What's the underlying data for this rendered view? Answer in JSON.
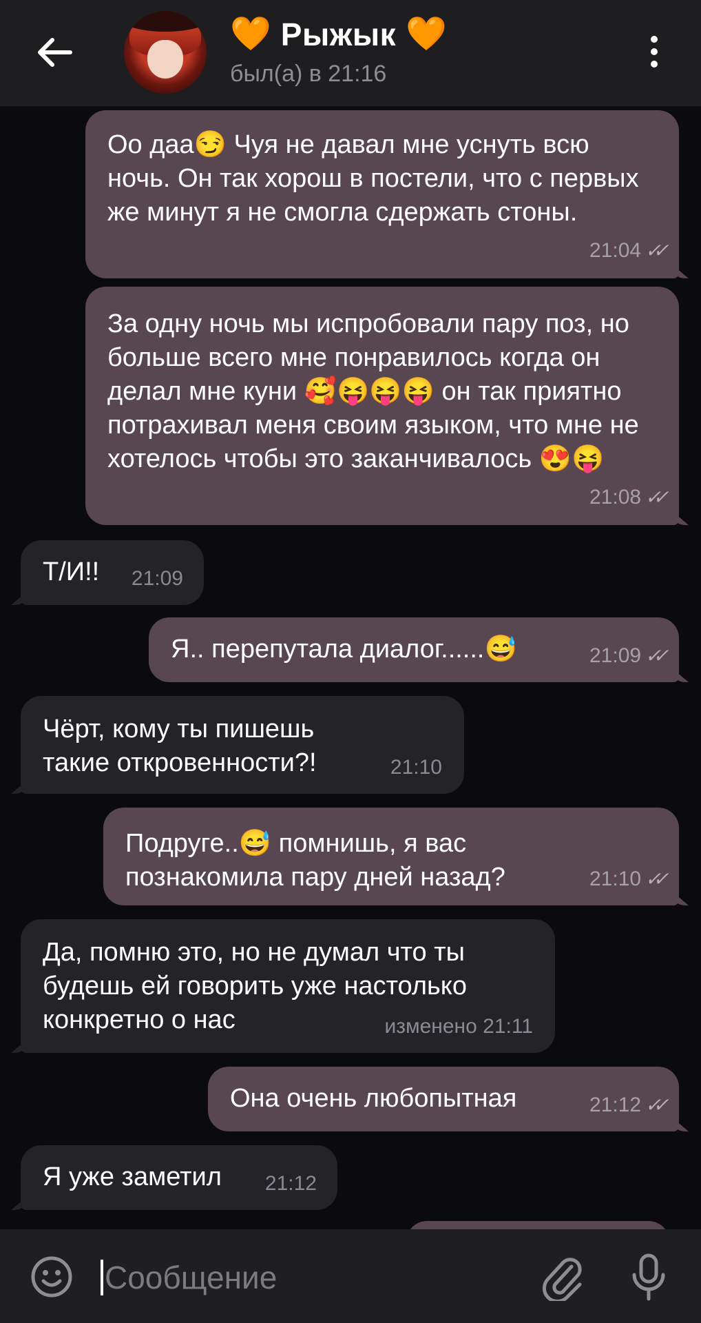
{
  "header": {
    "back_icon": "arrow-left-icon",
    "heart_left": "🧡",
    "name": "Рыжык",
    "heart_right": "🧡",
    "status": "был(а) в 21:16",
    "menu_icon": "more-vertical-icon"
  },
  "messages": [
    {
      "dir": "out",
      "text": "Оо даа😏 Чуя не давал мне уснуть всю ночь. Он так хорош в постели, что с первых же минут я не смогла сдержать стоны.",
      "time": "21:04",
      "read": true
    },
    {
      "dir": "out",
      "text": "За одну ночь мы испробовали пару поз, но больше всего мне понравилось когда он делал мне куни 🥰😝😝😝 он так приятно потрахивал меня своим языком, что мне не хотелось чтобы это заканчивалось 😍😝",
      "time": "21:08",
      "read": true
    },
    {
      "dir": "in",
      "text": "Т/И!!",
      "time": "21:09"
    },
    {
      "dir": "out",
      "text": "Я.. перепутала диалог......😅",
      "time": "21:09",
      "read": true
    },
    {
      "dir": "in",
      "text": "Чёрт, кому ты пишешь такие откровенности?!",
      "time": "21:10"
    },
    {
      "dir": "out",
      "text": "Подруге..😅 помнишь, я вас познакомила пару дней назад?",
      "time": "21:10",
      "read": true
    },
    {
      "dir": "in",
      "text": "Да, помню это, но не думал что ты будешь ей говорить уже настолько конкретно о нас",
      "time": "изменено 21:11"
    },
    {
      "dir": "out",
      "text": "Она очень любопытная",
      "time": "21:12",
      "read": true
    },
    {
      "dir": "in",
      "text": "Я уже заметил",
      "time": "21:12"
    }
  ],
  "read_mark": "✓✓",
  "input": {
    "placeholder": "Сообщение",
    "emoji_icon": "smile-icon",
    "attach_icon": "paperclip-icon",
    "mic_icon": "microphone-icon"
  },
  "colors": {
    "outgoing_bubble": "#584650",
    "incoming_bubble": "#242428",
    "background": "#0b0b0d",
    "header": "#1e1e20",
    "accent_heart": "#ff8a1c"
  }
}
